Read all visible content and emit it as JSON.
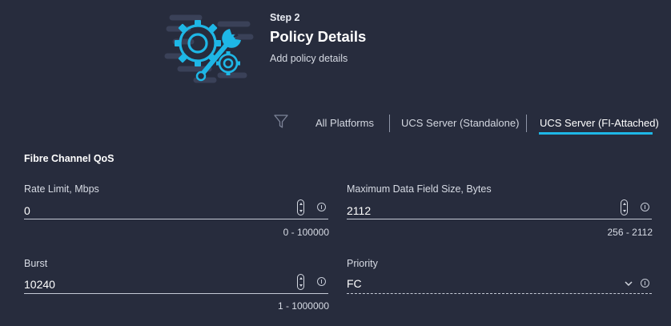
{
  "header": {
    "step_label": "Step 2",
    "title": "Policy Details",
    "subtitle": "Add policy details",
    "illustration_icon": "gear-wrench-icon"
  },
  "platform_filter": {
    "icon": "filter-icon",
    "tabs": [
      {
        "label": "All Platforms",
        "selected": false
      },
      {
        "label": "UCS Server (Standalone)",
        "selected": false
      },
      {
        "label": "UCS Server (FI-Attached)",
        "selected": true
      }
    ],
    "active_color": "#1eb7e6"
  },
  "section": {
    "title": "Fibre Channel QoS"
  },
  "fields": {
    "rate_limit": {
      "label": "Rate Limit, Mbps",
      "value": "0",
      "range": "0 - 100000"
    },
    "max_data_field": {
      "label": "Maximum Data Field Size, Bytes",
      "value": "2112",
      "range": "256 - 2112"
    },
    "burst": {
      "label": "Burst",
      "value": "10240",
      "range": "1 - 1000000"
    },
    "priority": {
      "label": "Priority",
      "value": "FC",
      "options": [
        "FC"
      ]
    }
  },
  "colors": {
    "background": "#272c3d",
    "text": "#ffffff",
    "accent": "#1eb7e6"
  }
}
